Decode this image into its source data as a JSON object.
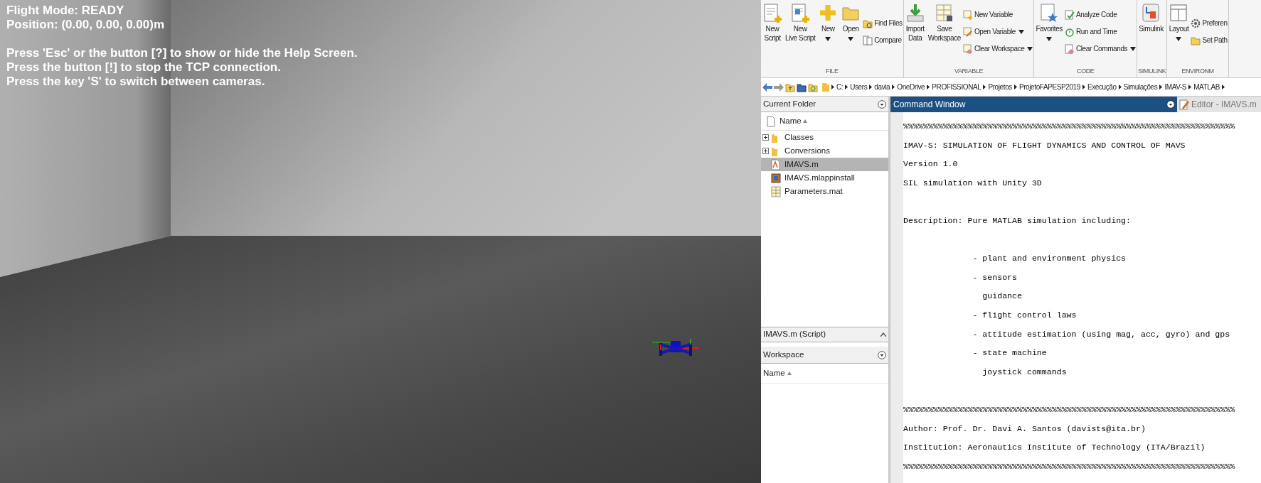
{
  "simulation_view": {
    "status_lines": [
      "Flight Mode: READY",
      "Position: (0.00, 0.00, 0.00)m"
    ],
    "help_lines": [
      "Press 'Esc' or the button [?] to show or hide the Help Screen.",
      "Press the button [!] to stop the TCP connection.",
      "Press the key 'S' to switch between cameras."
    ]
  },
  "toolstrip": {
    "groups": [
      {
        "label": "FILE",
        "items": [
          {
            "kind": "large",
            "label": "New\nScript",
            "menu": false
          },
          {
            "kind": "large",
            "label": "New\nLive Script",
            "menu": false
          },
          {
            "kind": "large",
            "label": "New",
            "menu": true
          },
          {
            "kind": "large",
            "label": "Open",
            "menu": true
          },
          {
            "kind": "small",
            "label": "Find Files",
            "menu": false
          },
          {
            "kind": "small",
            "label": "Compare",
            "menu": false
          }
        ]
      },
      {
        "label": "VARIABLE",
        "items": [
          {
            "kind": "large",
            "label": "Import\nData",
            "menu": false
          },
          {
            "kind": "large",
            "label": "Save\nWorkspace",
            "menu": false
          },
          {
            "kind": "small",
            "label": "New Variable",
            "menu": false
          },
          {
            "kind": "small",
            "label": "Open Variable",
            "menu": true
          },
          {
            "kind": "small",
            "label": "Clear Workspace",
            "menu": true
          }
        ]
      },
      {
        "label": "CODE",
        "items": [
          {
            "kind": "large",
            "label": "Favorites",
            "menu": true
          },
          {
            "kind": "small",
            "label": "Analyze Code",
            "menu": false
          },
          {
            "kind": "small",
            "label": "Run and Time",
            "menu": false
          },
          {
            "kind": "small",
            "label": "Clear Commands",
            "menu": true
          }
        ]
      },
      {
        "label": "SIMULINK",
        "items": [
          {
            "kind": "large",
            "label": "Simulink",
            "menu": false
          }
        ]
      },
      {
        "label": "ENVIRONM",
        "items": [
          {
            "kind": "large",
            "label": "Layout",
            "menu": true
          },
          {
            "kind": "small",
            "label": "Preferen",
            "menu": false
          },
          {
            "kind": "small",
            "label": "Set Path",
            "menu": false
          }
        ]
      }
    ]
  },
  "path_bar": {
    "segments": [
      "C:",
      "Users",
      "davia",
      "OneDrive",
      "PROFISSIONAL",
      "Projetos",
      "ProjetoFAPESP2019",
      "Execução",
      "Simulações",
      "IMAV-S",
      "MATLAB"
    ]
  },
  "current_folder": {
    "title": "Current Folder",
    "column": "Name",
    "items": [
      {
        "kind": "folder",
        "name": "Classes",
        "expanded": false,
        "selected": false
      },
      {
        "kind": "folder",
        "name": "Conversions",
        "expanded": false,
        "selected": false
      },
      {
        "kind": "script",
        "name": "IMAVS.m",
        "selected": true
      },
      {
        "kind": "app",
        "name": "IMAVS.mlappinstall",
        "selected": false
      },
      {
        "kind": "data",
        "name": "Parameters.mat",
        "selected": false
      }
    ],
    "details": "IMAVS.m (Script)"
  },
  "workspace": {
    "title": "Workspace",
    "column": "Name"
  },
  "command_window": {
    "title": "Command Window",
    "editor_tab": "Editor - IMAVS.m",
    "lines": [
      {
        "kind": "text",
        "text": "%%%%%%%%%%%%%%%%%%%%%%%%%%%%%%%%%%%%%%%%%%%%%%%%%%%%%%%%%%%%%%%%%%%"
      },
      {
        "kind": "text",
        "text": "IMAV-S: SIMULATION OF FLIGHT DYNAMICS AND CONTROL OF MAVS"
      },
      {
        "kind": "text",
        "text": "Version 1.0"
      },
      {
        "kind": "text",
        "text": "SIL simulation with Unity 3D"
      },
      {
        "kind": "blank"
      },
      {
        "kind": "text",
        "text": "Description: Pure MATLAB simulation including:"
      },
      {
        "kind": "blank"
      },
      {
        "kind": "text",
        "text": "              - plant and environment physics"
      },
      {
        "kind": "text",
        "text": "              - sensors"
      },
      {
        "kind": "text",
        "text": "                guidance"
      },
      {
        "kind": "text",
        "text": "              - flight control laws"
      },
      {
        "kind": "text",
        "text": "              - attitude estimation (using mag, acc, gyro) and gps"
      },
      {
        "kind": "text",
        "text": "              - state machine"
      },
      {
        "kind": "text",
        "text": "                joystick commands"
      },
      {
        "kind": "blank"
      },
      {
        "kind": "text",
        "text": "%%%%%%%%%%%%%%%%%%%%%%%%%%%%%%%%%%%%%%%%%%%%%%%%%%%%%%%%%%%%%%%%%%%"
      },
      {
        "kind": "text",
        "text": "Author: Prof. Dr. Davi A. Santos (davists@ita.br)"
      },
      {
        "kind": "text",
        "text": "Institution: Aeronautics Institute of Technology (ITA/Brazil)"
      },
      {
        "kind": "text",
        "text": "%%%%%%%%%%%%%%%%%%%%%%%%%%%%%%%%%%%%%%%%%%%%%%%%%%%%%%%%%%%%%%%%%%%"
      }
    ]
  }
}
